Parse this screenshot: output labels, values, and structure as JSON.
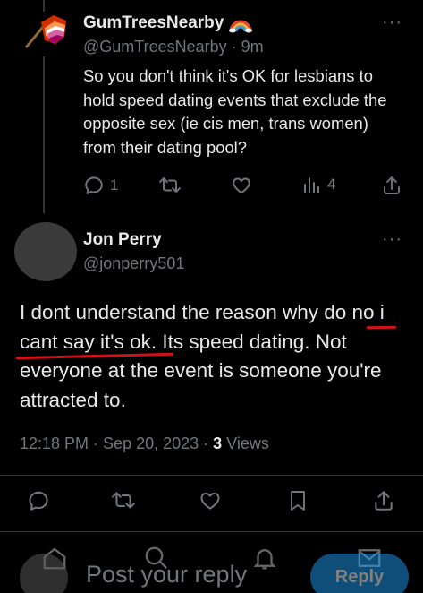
{
  "parent_tweet": {
    "display_name": "GumTreesNearby",
    "handle": "@GumTreesNearby",
    "separator": "·",
    "time": "9m",
    "text": "So you don't think it's OK for lesbians to hold speed dating events that exclude the opposite sex (ie cis men, trans women) from their dating pool?",
    "reply_count": "1",
    "view_count": "4",
    "more_label": "···",
    "icons": {
      "avatar": "lesbian-flag-icon",
      "name_emoji": "rainbow-icon",
      "reply": "reply-icon",
      "retweet": "retweet-icon",
      "like": "like-icon",
      "views": "views-icon",
      "share": "share-icon"
    }
  },
  "main_tweet": {
    "display_name": "Jon Perry",
    "handle": "@jonperry501",
    "more_label": "···",
    "text": "I dont understand the reason why do no i cant say it's ok. Its speed dating. Not everyone at the event is someone you're attracted to.",
    "time": "12:18 PM",
    "separator": "·",
    "date": "Sep 20, 2023",
    "separator2": "·",
    "views_count": "3",
    "views_label": "Views",
    "annotation_color": "#d0121b",
    "icons": {
      "reply": "reply-icon",
      "retweet": "retweet-icon",
      "like": "like-icon",
      "bookmark": "bookmark-icon",
      "share": "share-icon"
    }
  },
  "composer": {
    "placeholder": "Post your reply",
    "reply_button": "Reply",
    "accent_color": "#1d9bf0"
  },
  "colors": {
    "background": "#000000",
    "text": "#e7e9ea",
    "muted": "#71767b"
  }
}
